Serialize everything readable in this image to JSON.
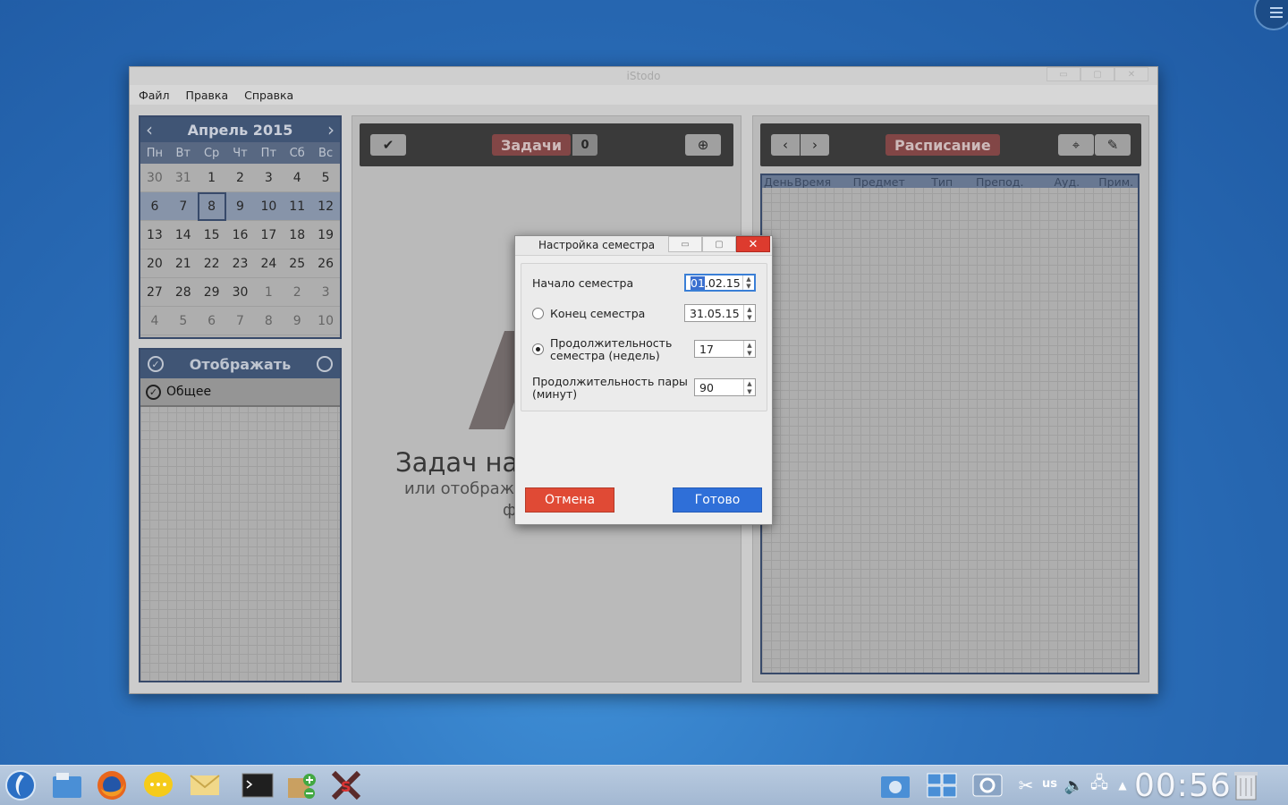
{
  "main_window": {
    "title": "iStodo",
    "menu": [
      "Файл",
      "Правка",
      "Справка"
    ]
  },
  "calendar": {
    "month_title": "Апрель 2015",
    "weekdays": [
      "Пн",
      "Вт",
      "Ср",
      "Чт",
      "Пт",
      "Сб",
      "Вс"
    ],
    "weeks": [
      [
        "30",
        "31",
        "1",
        "2",
        "3",
        "4",
        "5"
      ],
      [
        "6",
        "7",
        "8",
        "9",
        "10",
        "11",
        "12"
      ],
      [
        "13",
        "14",
        "15",
        "16",
        "17",
        "18",
        "19"
      ],
      [
        "20",
        "21",
        "22",
        "23",
        "24",
        "25",
        "26"
      ],
      [
        "27",
        "28",
        "29",
        "30",
        "1",
        "2",
        "3"
      ],
      [
        "4",
        "5",
        "6",
        "7",
        "8",
        "9",
        "10"
      ]
    ],
    "today": "8"
  },
  "display_panel": {
    "title": "Отображать",
    "items": [
      "Общее"
    ]
  },
  "tasks_panel": {
    "label": "Задачи",
    "count": "0",
    "empty_title": "Задач на",
    "empty_sub": "или отображ",
    "empty_sub2": "ф"
  },
  "schedule_panel": {
    "label": "Расписание",
    "columns": [
      "День",
      "Время",
      "Предмет",
      "Тип",
      "Препод.",
      "Ауд.",
      "Прим."
    ]
  },
  "dialog": {
    "title": "Настройка семестра",
    "start_label": "Начало семестра",
    "start_value_sel": "01",
    "start_value_rest": ".02.15",
    "end_label": "Конец семестра",
    "end_value": "31.05.15",
    "duration_label_1": "Продолжительность",
    "duration_label_2": "семестра (недель)",
    "duration_value": "17",
    "pair_label_1": "Продолжительность пары",
    "pair_label_2": "(минут)",
    "pair_value": "90",
    "cancel_label": "Отмена",
    "ok_label": "Готово"
  },
  "taskbar": {
    "clock": "00:56",
    "layout": "us"
  }
}
